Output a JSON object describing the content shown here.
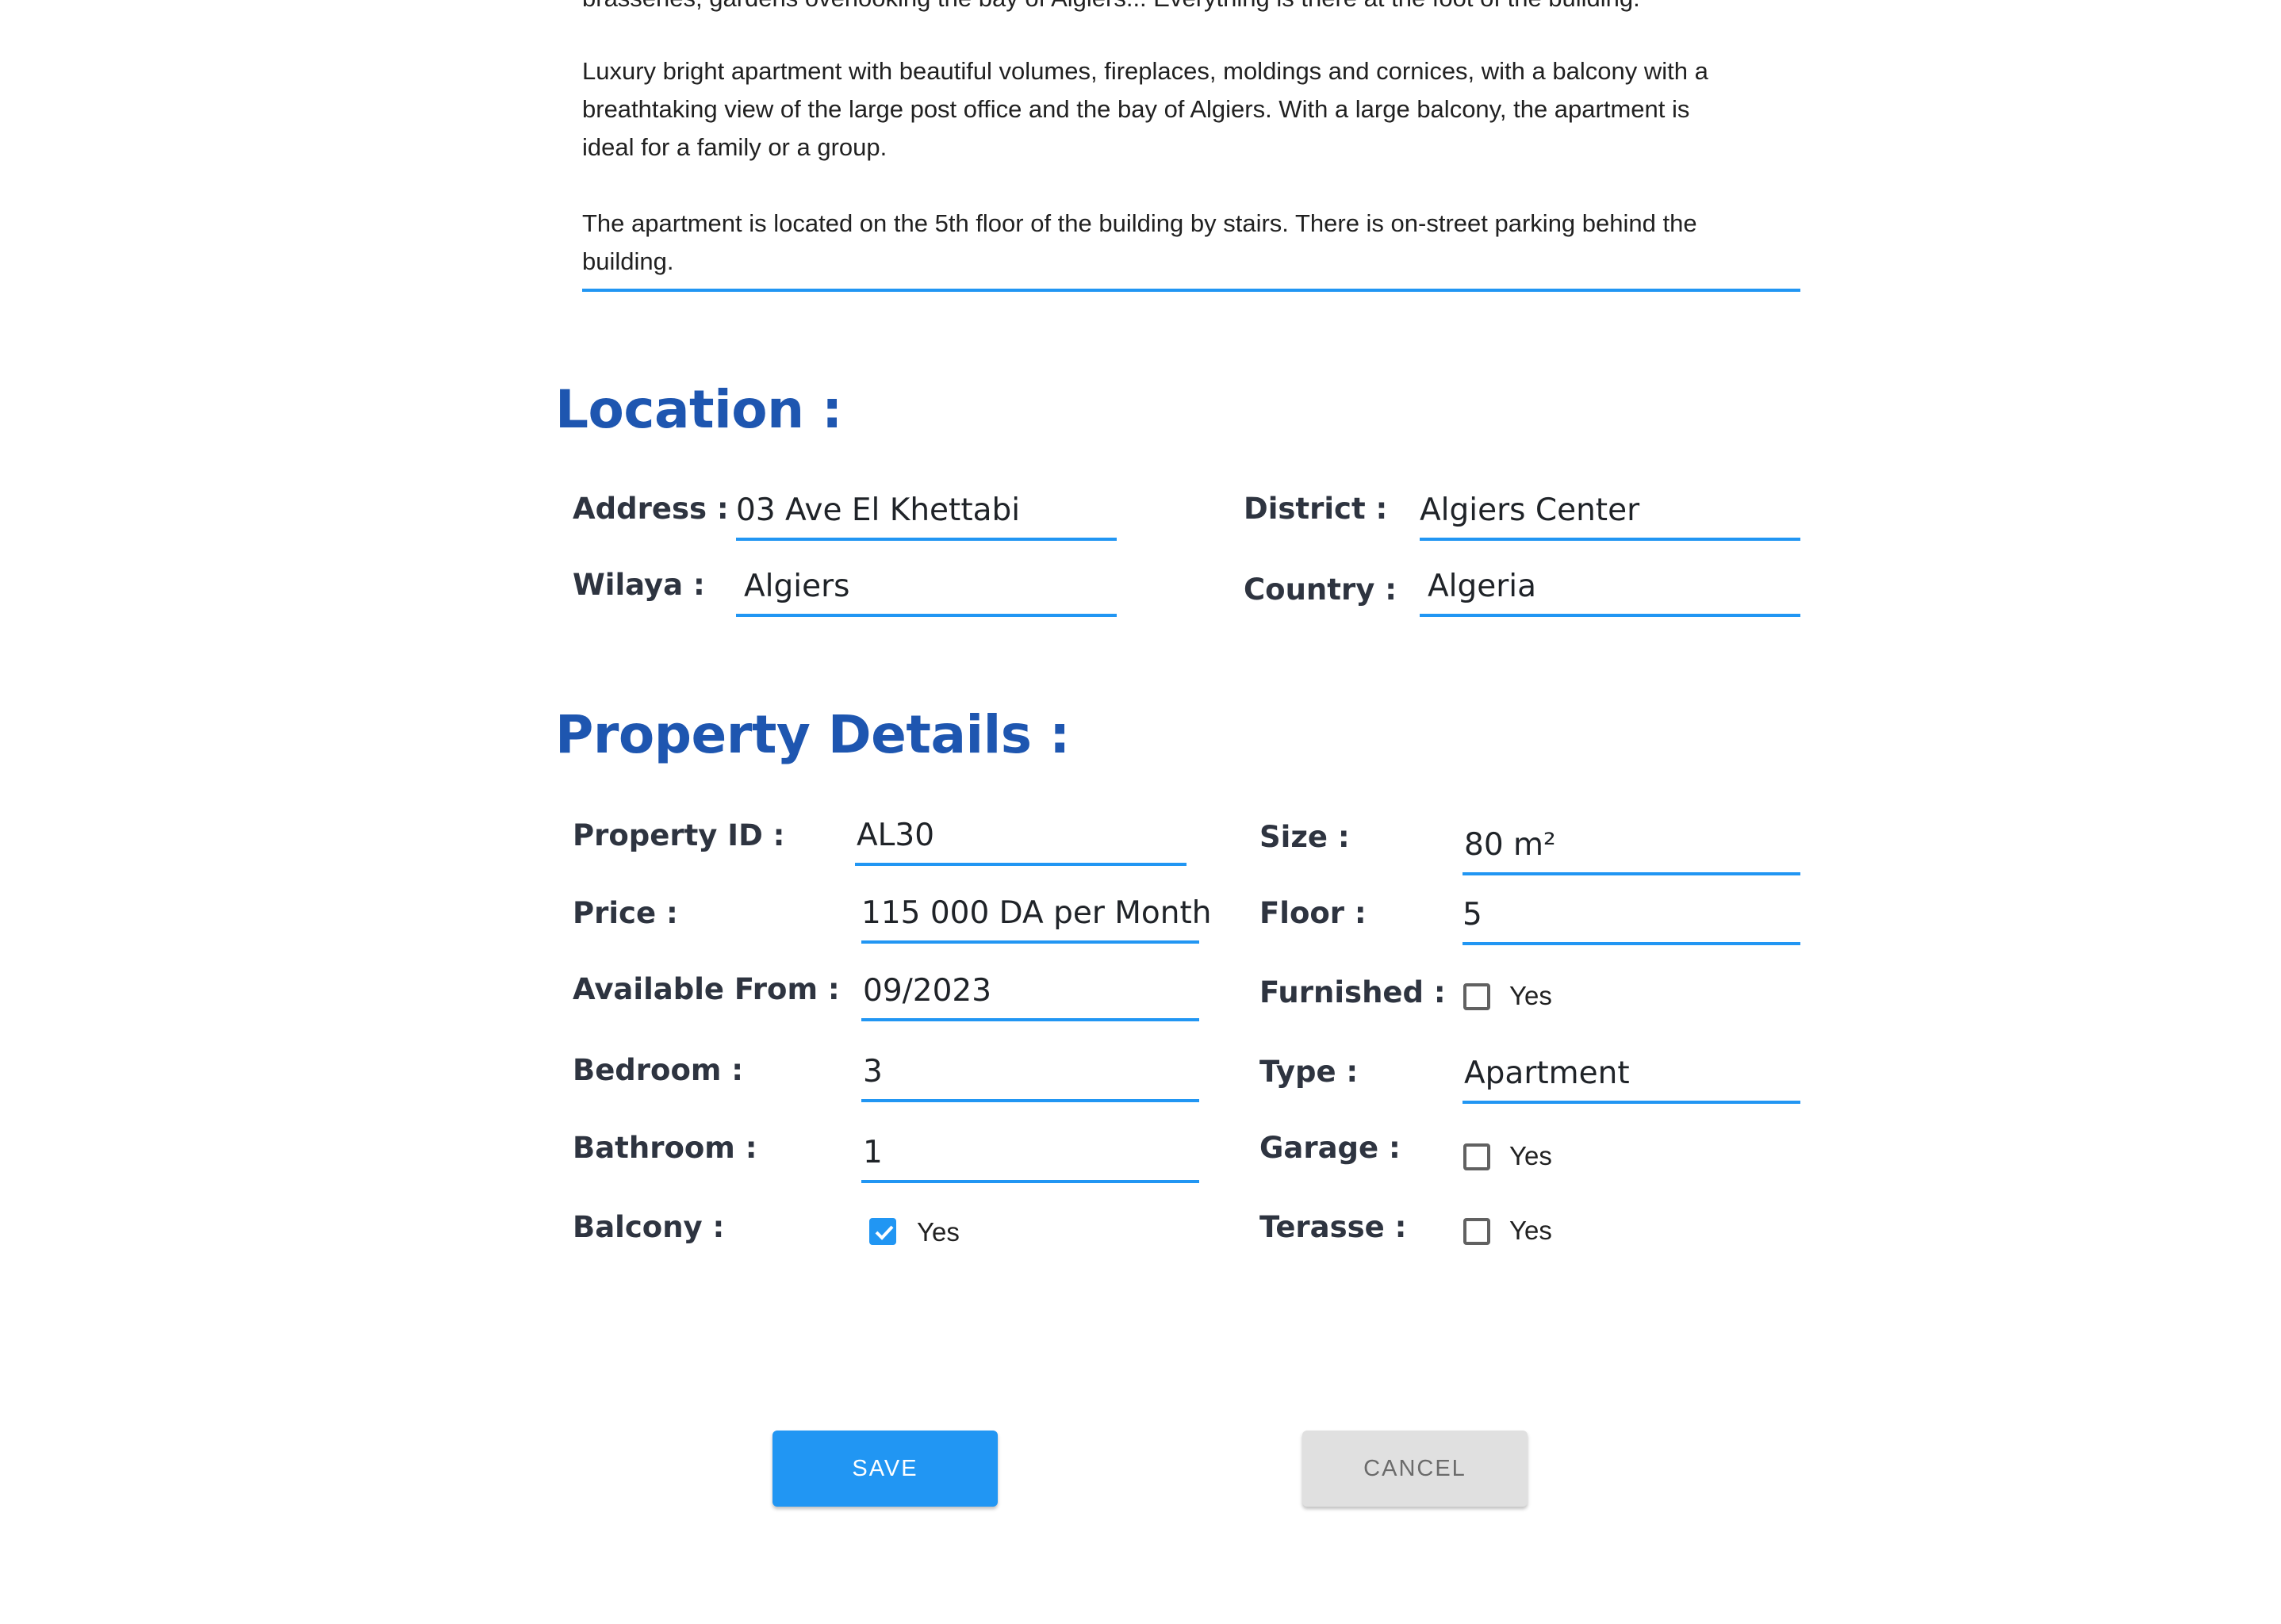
{
  "description": {
    "lines": [
      "brasseries, gardens overlooking the bay of Algiers... Everything is there at the foot of the building.",
      "Luxury bright apartment with beautiful volumes, fireplaces, moldings and cornices, with a balcony with a",
      "breathtaking view of the large post office and the bay of Algiers. With a large balcony, the apartment is",
      "ideal for a family or a group.",
      "The apartment is located on the 5th floor of the building by stairs. There is on-street parking behind the",
      "building."
    ]
  },
  "location": {
    "title": "Location :",
    "address": {
      "label": "Address :",
      "value": "03 Ave El Khettabi"
    },
    "district": {
      "label": "District :",
      "value": "Algiers Center"
    },
    "wilaya": {
      "label": "Wilaya :",
      "value": "Algiers"
    },
    "country": {
      "label": "Country :",
      "value": "Algeria"
    }
  },
  "property": {
    "title": "Property Details :",
    "property_id": {
      "label": "Property ID :",
      "value": "AL30"
    },
    "size": {
      "label": "Size :",
      "value": "80 m²"
    },
    "price": {
      "label": "Price :",
      "value": "115 000 DA per Month"
    },
    "floor": {
      "label": "Floor :",
      "value": "5"
    },
    "available_from": {
      "label": "Available From  :",
      "value": "09/2023"
    },
    "furnished": {
      "label": "Furnished :",
      "option": "Yes",
      "checked": false
    },
    "bedroom": {
      "label": "Bedroom :",
      "value": "3"
    },
    "type": {
      "label": "Type :",
      "value": "Apartment"
    },
    "bathroom": {
      "label": "Bathroom :",
      "value": "1"
    },
    "garage": {
      "label": "Garage :",
      "option": "Yes",
      "checked": false
    },
    "balcony": {
      "label": "Balcony :",
      "option": "Yes",
      "checked": true
    },
    "terasse": {
      "label": "Terasse :",
      "option": "Yes",
      "checked": false
    }
  },
  "actions": {
    "save_label": "SAVE",
    "cancel_label": "CANCEL"
  },
  "colors": {
    "accent": "#2196f3",
    "heading": "#1e56b0"
  }
}
